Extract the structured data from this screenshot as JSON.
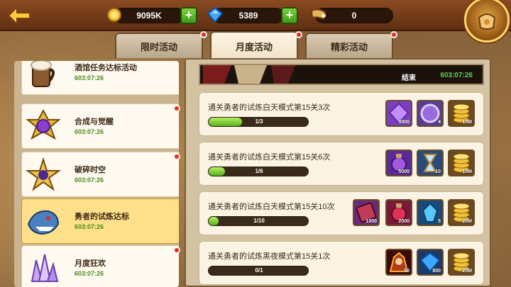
{
  "topbar": {
    "gold": "9095K",
    "gems": "5389",
    "special": "0"
  },
  "tabs": [
    {
      "label": "限时活动",
      "active": false
    },
    {
      "label": "月度活动",
      "active": true
    },
    {
      "label": "精彩活动",
      "active": false
    }
  ],
  "sidebar": {
    "items": [
      {
        "title": "酒馆任务达标活动",
        "time": "603:07:26",
        "icon": "beer-mug-icon",
        "selected": false,
        "alert": false
      },
      {
        "title": "合成与觉醒",
        "time": "603:07:26",
        "icon": "hexagram-orb-icon",
        "selected": false,
        "alert": true
      },
      {
        "title": "破碎时空",
        "time": "603:07:26",
        "icon": "shattered-star-icon",
        "selected": false,
        "alert": true
      },
      {
        "title": "勇者的试炼达标",
        "time": "603:07:26",
        "icon": "shark-warrior-icon",
        "selected": true,
        "alert": false
      },
      {
        "title": "月度狂欢",
        "time": "603:07:26",
        "icon": "crystal-cluster-icon",
        "selected": false,
        "alert": true
      }
    ]
  },
  "banner": {
    "end_label": "结束",
    "time": "603:07:26"
  },
  "quests": [
    {
      "title": "通关勇者的试炼白天模式第15关3次",
      "progress_text": "1/3",
      "progress": 0.333,
      "rewards": [
        {
          "icon": "purple-crystal-icon",
          "count": "3000"
        },
        {
          "icon": "purple-orb-icon",
          "count": "4"
        },
        {
          "icon": "gold-coins-icon",
          "count": "10M"
        }
      ]
    },
    {
      "title": "通关勇者的试炼白天模式第15关6次",
      "progress_text": "1/6",
      "progress": 0.167,
      "rewards": [
        {
          "icon": "purple-potion-icon",
          "count": "5000"
        },
        {
          "icon": "hourglass-scroll-icon",
          "count": "10"
        },
        {
          "icon": "gold-coins-icon",
          "count": "15M"
        }
      ]
    },
    {
      "title": "通关勇者的试炼白天模式第15关10次",
      "progress_text": "1/10",
      "progress": 0.1,
      "rewards": [
        {
          "icon": "red-scroll-icon",
          "count": "1000"
        },
        {
          "icon": "red-potion-icon",
          "count": "2000"
        },
        {
          "icon": "blue-crystal-icon",
          "count": "5"
        },
        {
          "icon": "gold-coins-icon",
          "count": "20M"
        }
      ]
    },
    {
      "title": "通关勇者的试炼黑夜模式第15关1次",
      "progress_text": "0/1",
      "progress": 0,
      "rewards": [
        {
          "icon": "hero-portrait-icon",
          "count": "50"
        },
        {
          "icon": "blue-gem-icon",
          "count": "800"
        },
        {
          "icon": "gold-coins-icon",
          "count": "25M"
        }
      ]
    }
  ],
  "colors": {
    "progress_green": "#56b21c",
    "time_green": "#4b8a1e",
    "selected_item": "#ffe08a",
    "alert_red": "#e02b2b"
  }
}
